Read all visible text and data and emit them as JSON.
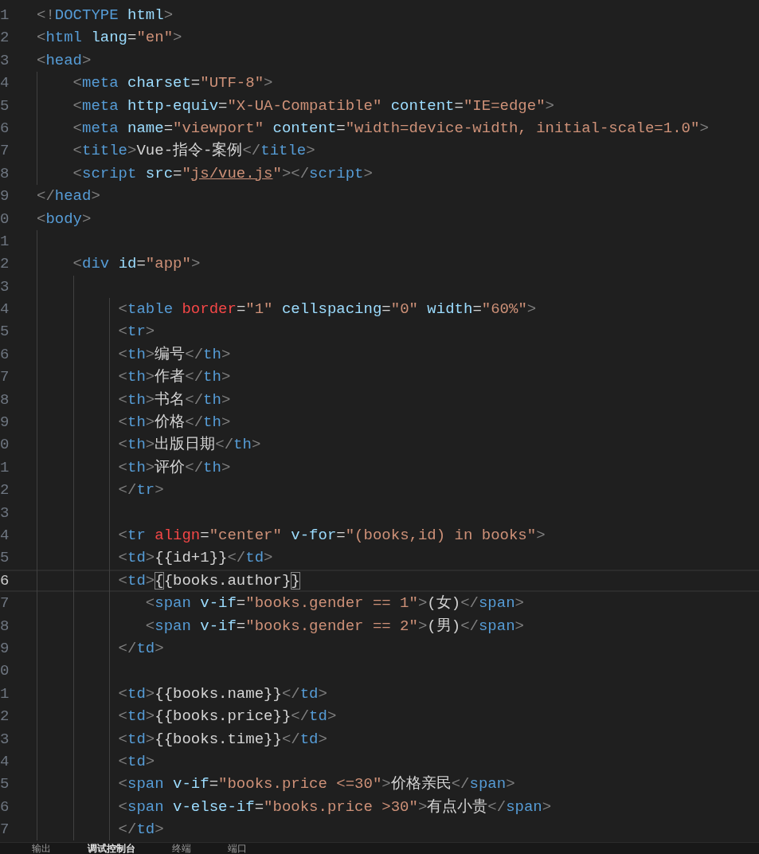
{
  "editor": {
    "lines": [
      {
        "n": "1",
        "current": false,
        "tokens": [
          {
            "kind": "p",
            "text": "<!"
          },
          {
            "kind": "tag",
            "text": "DOCTYPE"
          },
          {
            "kind": "attr",
            "text": " html"
          },
          {
            "kind": "p",
            "text": ">"
          }
        ]
      },
      {
        "n": "2",
        "current": false,
        "tokens": [
          {
            "kind": "p",
            "text": "<"
          },
          {
            "kind": "tag",
            "text": "html"
          },
          {
            "kind": "attr",
            "text": " lang"
          },
          {
            "kind": "t",
            "text": "="
          },
          {
            "kind": "str",
            "text": "\"en\""
          },
          {
            "kind": "p",
            "text": ">"
          }
        ]
      },
      {
        "n": "3",
        "current": false,
        "tokens": [
          {
            "kind": "p",
            "text": "<"
          },
          {
            "kind": "tag",
            "text": "head"
          },
          {
            "kind": "p",
            "text": ">"
          }
        ]
      },
      {
        "n": "4",
        "current": false,
        "tokens": [
          {
            "kind": "p",
            "text": "    <"
          },
          {
            "kind": "tag",
            "text": "meta"
          },
          {
            "kind": "attr",
            "text": " charset"
          },
          {
            "kind": "t",
            "text": "="
          },
          {
            "kind": "str",
            "text": "\"UTF-8\""
          },
          {
            "kind": "p",
            "text": ">"
          }
        ]
      },
      {
        "n": "5",
        "current": false,
        "tokens": [
          {
            "kind": "p",
            "text": "    <"
          },
          {
            "kind": "tag",
            "text": "meta"
          },
          {
            "kind": "attr",
            "text": " http-equiv"
          },
          {
            "kind": "t",
            "text": "="
          },
          {
            "kind": "str",
            "text": "\"X-UA-Compatible\""
          },
          {
            "kind": "attr",
            "text": " content"
          },
          {
            "kind": "t",
            "text": "="
          },
          {
            "kind": "str",
            "text": "\"IE=edge\""
          },
          {
            "kind": "p",
            "text": ">"
          }
        ]
      },
      {
        "n": "6",
        "current": false,
        "tokens": [
          {
            "kind": "p",
            "text": "    <"
          },
          {
            "kind": "tag",
            "text": "meta"
          },
          {
            "kind": "attr",
            "text": " name"
          },
          {
            "kind": "t",
            "text": "="
          },
          {
            "kind": "str",
            "text": "\"viewport\""
          },
          {
            "kind": "attr",
            "text": " content"
          },
          {
            "kind": "t",
            "text": "="
          },
          {
            "kind": "str",
            "text": "\"width=device-width, initial-scale=1.0\""
          },
          {
            "kind": "p",
            "text": ">"
          }
        ]
      },
      {
        "n": "7",
        "current": false,
        "tokens": [
          {
            "kind": "p",
            "text": "    <"
          },
          {
            "kind": "tag",
            "text": "title"
          },
          {
            "kind": "p",
            "text": ">"
          },
          {
            "kind": "t",
            "text": "Vue-指令-案例"
          },
          {
            "kind": "p",
            "text": "</"
          },
          {
            "kind": "tag",
            "text": "title"
          },
          {
            "kind": "p",
            "text": ">"
          }
        ]
      },
      {
        "n": "8",
        "current": false,
        "tokens": [
          {
            "kind": "p",
            "text": "    <"
          },
          {
            "kind": "tag",
            "text": "script"
          },
          {
            "kind": "attr",
            "text": " src"
          },
          {
            "kind": "t",
            "text": "="
          },
          {
            "kind": "str",
            "text": "\""
          },
          {
            "kind": "link",
            "text": "js/vue.js"
          },
          {
            "kind": "str",
            "text": "\""
          },
          {
            "kind": "p",
            "text": "></"
          },
          {
            "kind": "tag",
            "text": "script"
          },
          {
            "kind": "p",
            "text": ">"
          }
        ]
      },
      {
        "n": "9",
        "current": false,
        "tokens": [
          {
            "kind": "p",
            "text": "</"
          },
          {
            "kind": "tag",
            "text": "head"
          },
          {
            "kind": "p",
            "text": ">"
          }
        ]
      },
      {
        "n": "0",
        "current": false,
        "tokens": [
          {
            "kind": "p",
            "text": "<"
          },
          {
            "kind": "tag",
            "text": "body"
          },
          {
            "kind": "p",
            "text": ">"
          }
        ]
      },
      {
        "n": "1",
        "current": false
      },
      {
        "n": "2",
        "current": false,
        "tokens": [
          {
            "kind": "p",
            "text": "    <"
          },
          {
            "kind": "tag",
            "text": "div"
          },
          {
            "kind": "attr",
            "text": " id"
          },
          {
            "kind": "t",
            "text": "="
          },
          {
            "kind": "str",
            "text": "\"app\""
          },
          {
            "kind": "p",
            "text": ">"
          }
        ]
      },
      {
        "n": "3",
        "current": false
      },
      {
        "n": "4",
        "current": false,
        "tokens": [
          {
            "kind": "p",
            "text": "         <"
          },
          {
            "kind": "tag",
            "text": "table"
          },
          {
            "kind": "dattr",
            "text": " border"
          },
          {
            "kind": "t",
            "text": "="
          },
          {
            "kind": "str",
            "text": "\"1\""
          },
          {
            "kind": "attr",
            "text": " cellspacing"
          },
          {
            "kind": "t",
            "text": "="
          },
          {
            "kind": "str",
            "text": "\"0\""
          },
          {
            "kind": "attr",
            "text": " width"
          },
          {
            "kind": "t",
            "text": "="
          },
          {
            "kind": "str",
            "text": "\"60%\""
          },
          {
            "kind": "p",
            "text": ">"
          }
        ]
      },
      {
        "n": "5",
        "current": false,
        "tokens": [
          {
            "kind": "p",
            "text": "         <"
          },
          {
            "kind": "tag",
            "text": "tr"
          },
          {
            "kind": "p",
            "text": ">"
          }
        ]
      },
      {
        "n": "6",
        "current": false,
        "tokens": [
          {
            "kind": "p",
            "text": "         <"
          },
          {
            "kind": "tag",
            "text": "th"
          },
          {
            "kind": "p",
            "text": ">"
          },
          {
            "kind": "t",
            "text": "编号"
          },
          {
            "kind": "p",
            "text": "</"
          },
          {
            "kind": "tag",
            "text": "th"
          },
          {
            "kind": "p",
            "text": ">"
          }
        ]
      },
      {
        "n": "7",
        "current": false,
        "tokens": [
          {
            "kind": "p",
            "text": "         <"
          },
          {
            "kind": "tag",
            "text": "th"
          },
          {
            "kind": "p",
            "text": ">"
          },
          {
            "kind": "t",
            "text": "作者"
          },
          {
            "kind": "p",
            "text": "</"
          },
          {
            "kind": "tag",
            "text": "th"
          },
          {
            "kind": "p",
            "text": ">"
          }
        ]
      },
      {
        "n": "8",
        "current": false,
        "tokens": [
          {
            "kind": "p",
            "text": "         <"
          },
          {
            "kind": "tag",
            "text": "th"
          },
          {
            "kind": "p",
            "text": ">"
          },
          {
            "kind": "t",
            "text": "书名"
          },
          {
            "kind": "p",
            "text": "</"
          },
          {
            "kind": "tag",
            "text": "th"
          },
          {
            "kind": "p",
            "text": ">"
          }
        ]
      },
      {
        "n": "9",
        "current": false,
        "tokens": [
          {
            "kind": "p",
            "text": "         <"
          },
          {
            "kind": "tag",
            "text": "th"
          },
          {
            "kind": "p",
            "text": ">"
          },
          {
            "kind": "t",
            "text": "价格"
          },
          {
            "kind": "p",
            "text": "</"
          },
          {
            "kind": "tag",
            "text": "th"
          },
          {
            "kind": "p",
            "text": ">"
          }
        ]
      },
      {
        "n": "0",
        "current": false,
        "tokens": [
          {
            "kind": "p",
            "text": "         <"
          },
          {
            "kind": "tag",
            "text": "th"
          },
          {
            "kind": "p",
            "text": ">"
          },
          {
            "kind": "t",
            "text": "出版日期"
          },
          {
            "kind": "p",
            "text": "</"
          },
          {
            "kind": "tag",
            "text": "th"
          },
          {
            "kind": "p",
            "text": ">"
          }
        ]
      },
      {
        "n": "1",
        "current": false,
        "tokens": [
          {
            "kind": "p",
            "text": "         <"
          },
          {
            "kind": "tag",
            "text": "th"
          },
          {
            "kind": "p",
            "text": ">"
          },
          {
            "kind": "t",
            "text": "评价"
          },
          {
            "kind": "p",
            "text": "</"
          },
          {
            "kind": "tag",
            "text": "th"
          },
          {
            "kind": "p",
            "text": ">"
          }
        ]
      },
      {
        "n": "2",
        "current": false,
        "tokens": [
          {
            "kind": "p",
            "text": "         </"
          },
          {
            "kind": "tag",
            "text": "tr"
          },
          {
            "kind": "p",
            "text": ">"
          }
        ]
      },
      {
        "n": "3",
        "current": false
      },
      {
        "n": "4",
        "current": false,
        "tokens": [
          {
            "kind": "p",
            "text": "         <"
          },
          {
            "kind": "tag",
            "text": "tr"
          },
          {
            "kind": "dattr",
            "text": " align"
          },
          {
            "kind": "t",
            "text": "="
          },
          {
            "kind": "str",
            "text": "\"center\""
          },
          {
            "kind": "attr",
            "text": " v-for"
          },
          {
            "kind": "t",
            "text": "="
          },
          {
            "kind": "str",
            "text": "\"(books,id) in books\""
          },
          {
            "kind": "p",
            "text": ">"
          }
        ]
      },
      {
        "n": "5",
        "current": false,
        "tokens": [
          {
            "kind": "p",
            "text": "         <"
          },
          {
            "kind": "tag",
            "text": "td"
          },
          {
            "kind": "p",
            "text": ">"
          },
          {
            "kind": "t",
            "text": "{{id+1}}"
          },
          {
            "kind": "p",
            "text": "</"
          },
          {
            "kind": "tag",
            "text": "td"
          },
          {
            "kind": "p",
            "text": ">"
          }
        ]
      },
      {
        "n": "6",
        "current": true,
        "tokens": [
          {
            "kind": "p",
            "text": "         <"
          },
          {
            "kind": "tag",
            "text": "td"
          },
          {
            "kind": "p",
            "text": ">"
          },
          {
            "kind": "bm",
            "text": "{"
          },
          {
            "kind": "t",
            "text": "{books.author}"
          },
          {
            "kind": "bm",
            "text": "}"
          }
        ]
      },
      {
        "n": "7",
        "current": false,
        "tokens": [
          {
            "kind": "p",
            "text": "            <"
          },
          {
            "kind": "tag",
            "text": "span"
          },
          {
            "kind": "attr",
            "text": " v-if"
          },
          {
            "kind": "t",
            "text": "="
          },
          {
            "kind": "str",
            "text": "\"books.gender == 1\""
          },
          {
            "kind": "p",
            "text": ">"
          },
          {
            "kind": "t",
            "text": "(女)"
          },
          {
            "kind": "p",
            "text": "</"
          },
          {
            "kind": "tag",
            "text": "span"
          },
          {
            "kind": "p",
            "text": ">"
          }
        ]
      },
      {
        "n": "8",
        "current": false,
        "tokens": [
          {
            "kind": "p",
            "text": "            <"
          },
          {
            "kind": "tag",
            "text": "span"
          },
          {
            "kind": "attr",
            "text": " v-if"
          },
          {
            "kind": "t",
            "text": "="
          },
          {
            "kind": "str",
            "text": "\"books.gender == 2\""
          },
          {
            "kind": "p",
            "text": ">"
          },
          {
            "kind": "t",
            "text": "(男)"
          },
          {
            "kind": "p",
            "text": "</"
          },
          {
            "kind": "tag",
            "text": "span"
          },
          {
            "kind": "p",
            "text": ">"
          }
        ]
      },
      {
        "n": "9",
        "current": false,
        "tokens": [
          {
            "kind": "p",
            "text": "         </"
          },
          {
            "kind": "tag",
            "text": "td"
          },
          {
            "kind": "p",
            "text": ">"
          }
        ]
      },
      {
        "n": "0",
        "current": false
      },
      {
        "n": "1",
        "current": false,
        "tokens": [
          {
            "kind": "p",
            "text": "         <"
          },
          {
            "kind": "tag",
            "text": "td"
          },
          {
            "kind": "p",
            "text": ">"
          },
          {
            "kind": "t",
            "text": "{{books.name}}"
          },
          {
            "kind": "p",
            "text": "</"
          },
          {
            "kind": "tag",
            "text": "td"
          },
          {
            "kind": "p",
            "text": ">"
          }
        ]
      },
      {
        "n": "2",
        "current": false,
        "tokens": [
          {
            "kind": "p",
            "text": "         <"
          },
          {
            "kind": "tag",
            "text": "td"
          },
          {
            "kind": "p",
            "text": ">"
          },
          {
            "kind": "t",
            "text": "{{books.price}}"
          },
          {
            "kind": "p",
            "text": "</"
          },
          {
            "kind": "tag",
            "text": "td"
          },
          {
            "kind": "p",
            "text": ">"
          }
        ]
      },
      {
        "n": "3",
        "current": false,
        "tokens": [
          {
            "kind": "p",
            "text": "         <"
          },
          {
            "kind": "tag",
            "text": "td"
          },
          {
            "kind": "p",
            "text": ">"
          },
          {
            "kind": "t",
            "text": "{{books.time}}"
          },
          {
            "kind": "p",
            "text": "</"
          },
          {
            "kind": "tag",
            "text": "td"
          },
          {
            "kind": "p",
            "text": ">"
          }
        ]
      },
      {
        "n": "4",
        "current": false,
        "tokens": [
          {
            "kind": "p",
            "text": "         <"
          },
          {
            "kind": "tag",
            "text": "td"
          },
          {
            "kind": "p",
            "text": ">"
          }
        ]
      },
      {
        "n": "5",
        "current": false,
        "tokens": [
          {
            "kind": "p",
            "text": "         <"
          },
          {
            "kind": "tag",
            "text": "span"
          },
          {
            "kind": "attr",
            "text": " v-if"
          },
          {
            "kind": "t",
            "text": "="
          },
          {
            "kind": "str",
            "text": "\"books.price <=30\""
          },
          {
            "kind": "p",
            "text": ">"
          },
          {
            "kind": "t",
            "text": "价格亲民"
          },
          {
            "kind": "p",
            "text": "</"
          },
          {
            "kind": "tag",
            "text": "span"
          },
          {
            "kind": "p",
            "text": ">"
          }
        ]
      },
      {
        "n": "6",
        "current": false,
        "tokens": [
          {
            "kind": "p",
            "text": "         <"
          },
          {
            "kind": "tag",
            "text": "span"
          },
          {
            "kind": "attr",
            "text": " v-else-if"
          },
          {
            "kind": "t",
            "text": "="
          },
          {
            "kind": "str",
            "text": "\"books.price >30\""
          },
          {
            "kind": "p",
            "text": ">"
          },
          {
            "kind": "t",
            "text": "有点小贵"
          },
          {
            "kind": "p",
            "text": "</"
          },
          {
            "kind": "tag",
            "text": "span"
          },
          {
            "kind": "p",
            "text": ">"
          }
        ]
      },
      {
        "n": "7",
        "current": false,
        "tokens": [
          {
            "kind": "p",
            "text": "         </"
          },
          {
            "kind": "tag",
            "text": "td"
          },
          {
            "kind": "p",
            "text": ">"
          }
        ]
      }
    ]
  },
  "panel": {
    "tabs": [
      {
        "label": "输出",
        "selected": false
      },
      {
        "label": "调试控制台",
        "selected": true
      },
      {
        "label": "终端",
        "selected": false
      },
      {
        "label": "端口",
        "selected": false
      }
    ]
  }
}
